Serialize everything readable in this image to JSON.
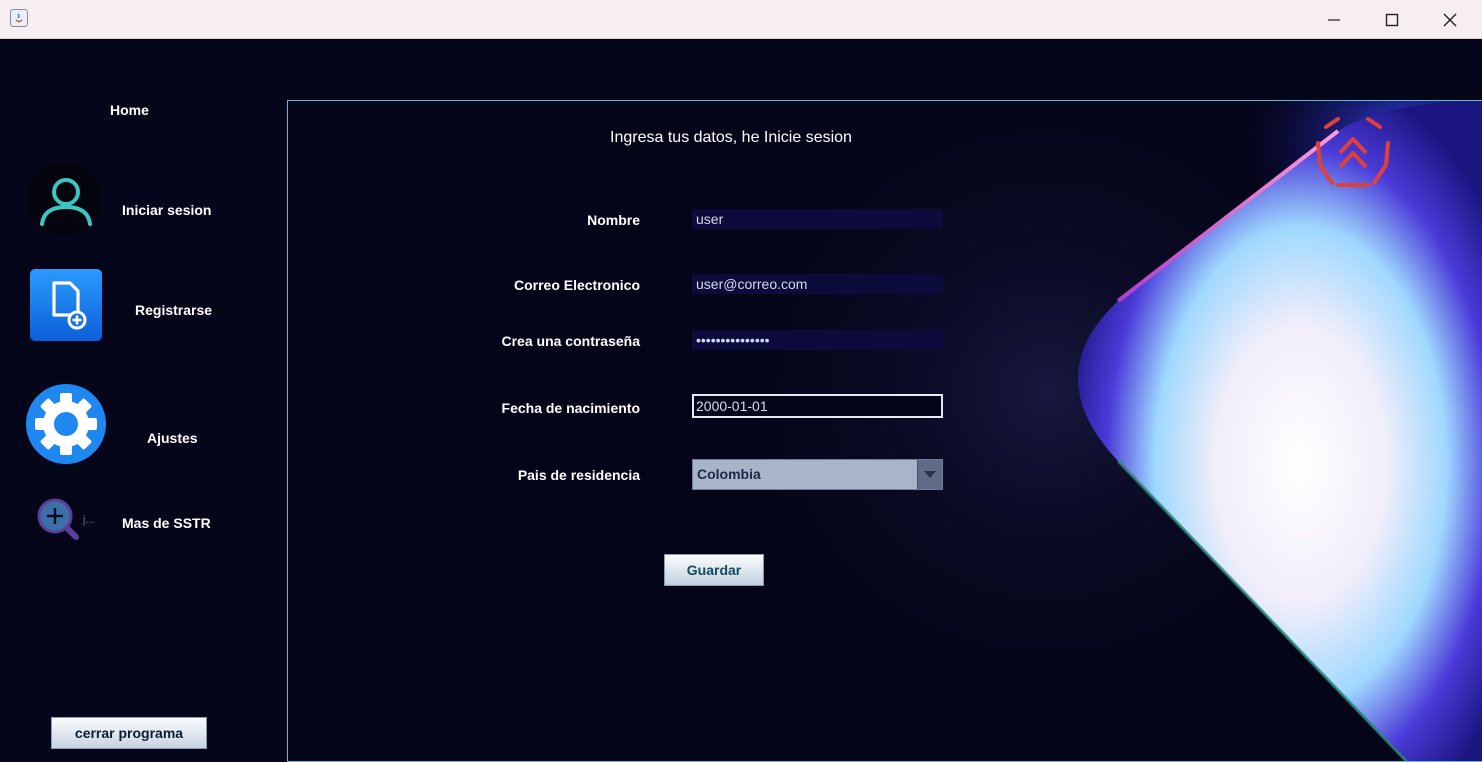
{
  "window": {
    "title": "",
    "controls": [
      "minimize-icon",
      "maximize-icon",
      "close-icon"
    ]
  },
  "sidebar": {
    "home_label": "Home",
    "items": [
      {
        "label": "Iniciar sesion",
        "icon": "user-icon"
      },
      {
        "label": "Registrarse",
        "icon": "add-document-icon"
      },
      {
        "label": "Ajustes",
        "icon": "gear-icon"
      },
      {
        "label": "Mas de SSTR",
        "icon": "zoom-in-icon",
        "icon_caption": "j..."
      }
    ],
    "close_button_label": "cerrar programa"
  },
  "form": {
    "title": "Ingresa tus datos, he Inicie sesion",
    "name_label": "Nombre",
    "name_value": "user",
    "email_label": "Correo Electronico",
    "email_value": "user@correo.com",
    "password_label": "Crea una contraseña",
    "password_value": "•••••••••••••••",
    "birthdate_label": "Fecha de nacimiento",
    "birthdate_value": "2000-01-01",
    "country_label": "Pais de residencia",
    "country_value": "Colombia",
    "save_label": "Guardar"
  },
  "colors": {
    "background": "#06061a",
    "panel_border": "#5cb8d8",
    "input_bg": "#0b0b3c",
    "user_icon": "#3cc6c2",
    "blue_icons": "#1e7ff0",
    "logo": "#e0403a"
  }
}
